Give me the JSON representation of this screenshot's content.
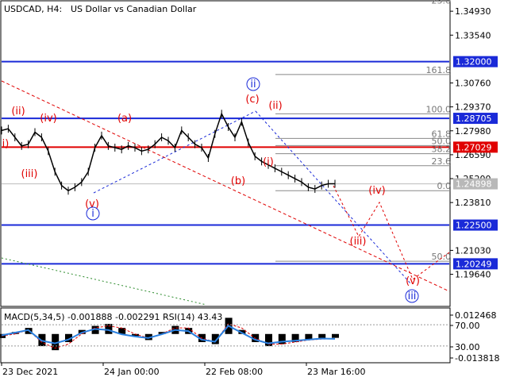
{
  "header": {
    "symbol": "USDCAD, H4:",
    "description": "US Dollar vs Canadian Dollar"
  },
  "colors": {
    "bg": "#ffffff",
    "axis": "#000000",
    "price_line_blue": "#1a2ad8",
    "price_line_red": "#e00000",
    "label_bg_blue": "#1a2ad8",
    "label_bg_red": "#e00000",
    "label_bg_gray": "#b8b8b8",
    "fib": "#808080",
    "candles": "#000000",
    "macd_hist": "#000000",
    "macd_signal": "#e00000",
    "rsi": "#2a80e0",
    "forecast_red": "#e00000",
    "forecast_blue": "#1a2ad8"
  },
  "chart_data": [
    {
      "type": "line",
      "title": "USDCAD, H4:  US Dollar vs Canadian Dollar",
      "ylim": [
        1.1782,
        1.3549
      ],
      "price_axis_ticks": [
        "1.34930",
        "1.33540",
        "1.30760",
        "1.29370",
        "1.27980",
        "1.26590",
        "1.25200",
        "1.23810",
        "1.21030",
        "1.19640"
      ],
      "x_labels": [
        "23 Dec 2021",
        "24 Jan 00:00",
        "22 Feb 08:00",
        "23 Mar 16:00"
      ],
      "grid": false,
      "levels": [
        {
          "value": 1.32,
          "label": "1.32000",
          "color": "#1a2ad8",
          "style": "solid"
        },
        {
          "value": 1.28705,
          "label": "1.28705",
          "color": "#1a2ad8",
          "style": "solid"
        },
        {
          "value": 1.27029,
          "label": "1.27029",
          "color": "#e00000",
          "style": "solid"
        },
        {
          "value": 1.24898,
          "label": "1.24898",
          "color": "#b8b8b8",
          "style": "current"
        },
        {
          "value": 1.225,
          "label": "1.22500",
          "color": "#1a2ad8",
          "style": "solid"
        },
        {
          "value": 1.20249,
          "label": "1.20249",
          "color": "#1a2ad8",
          "style": "solid"
        }
      ],
      "fibonacci": [
        {
          "label": "23.6",
          "value": 1.3528
        },
        {
          "label": "161.8",
          "value": 1.3125
        },
        {
          "label": "100.0",
          "value": 1.2897
        },
        {
          "label": "61.8",
          "value": 1.2754
        },
        {
          "label": "50.0",
          "value": 1.2712
        },
        {
          "label": "38.2",
          "value": 1.2665
        },
        {
          "label": "23.6",
          "value": 1.2595
        },
        {
          "label": "0.0",
          "value": 1.245
        },
        {
          "label": "50.0",
          "value": 1.204
        }
      ],
      "series": [
        {
          "name": "USDCAD H4 close",
          "x": [
            0,
            2,
            4,
            6,
            8,
            10,
            12,
            14,
            16,
            18,
            20,
            22,
            24,
            26,
            28,
            30,
            32,
            34,
            36,
            38,
            40,
            42,
            44,
            46,
            48,
            50,
            52,
            54,
            56,
            58,
            60,
            62,
            64,
            66,
            68,
            70,
            72,
            74,
            76,
            78,
            80,
            82,
            84,
            86,
            88,
            90,
            92,
            94,
            96,
            98,
            100
          ],
          "values": [
            1.28,
            1.281,
            1.276,
            1.271,
            1.272,
            1.279,
            1.276,
            1.268,
            1.256,
            1.248,
            1.245,
            1.247,
            1.25,
            1.256,
            1.27,
            1.277,
            1.271,
            1.27,
            1.269,
            1.271,
            1.27,
            1.268,
            1.269,
            1.272,
            1.276,
            1.274,
            1.27,
            1.28,
            1.276,
            1.272,
            1.27,
            1.264,
            1.278,
            1.2897,
            1.282,
            1.276,
            1.285,
            1.273,
            1.265,
            1.262,
            1.26,
            1.258,
            1.256,
            1.254,
            1.252,
            1.25,
            1.247,
            1.246,
            1.248,
            1.249,
            1.249
          ]
        }
      ],
      "wave_labels_red": [
        "(ii)",
        "(iv)",
        "(iii)",
        "(v)",
        "(a)",
        "(b)",
        "(c)",
        "(ii)",
        "(i)",
        "(iv)",
        "(iii)",
        "(v)",
        "i)"
      ],
      "wave_labels_blue": [
        "i",
        "ii",
        "iii"
      ]
    },
    {
      "type": "line",
      "title": "MACD(5,34,5) -0.001888 -0.002291 RSI(14) 43.43",
      "indicator_label": "MACD(5,34,5) -0.001888 -0.002291 RSI(14) 43.43",
      "ylim": [
        -0.013818,
        0.012468
      ],
      "axis_ticks": [
        "0.012468",
        "70.00",
        "30.00",
        "-0.013818"
      ],
      "x": [
        0,
        4,
        8,
        12,
        16,
        20,
        24,
        28,
        32,
        36,
        40,
        44,
        48,
        52,
        56,
        60,
        64,
        68,
        72,
        76,
        80,
        84,
        88,
        92,
        96,
        100
      ],
      "series": [
        {
          "name": "MACD(5,34,5) histogram",
          "values": [
            -0.002,
            0.001,
            0.003,
            -0.006,
            -0.008,
            -0.004,
            0.002,
            0.004,
            0.005,
            0.003,
            -0.001,
            -0.003,
            0.001,
            0.004,
            0.003,
            -0.004,
            -0.005,
            0.008,
            0.002,
            -0.004,
            -0.006,
            -0.005,
            -0.004,
            -0.003,
            -0.002,
            -0.0019
          ]
        },
        {
          "name": "MACD signal",
          "values": [
            -0.001,
            0.0,
            0.002,
            -0.004,
            -0.007,
            -0.005,
            0.0,
            0.003,
            0.004,
            0.003,
            0.0,
            -0.002,
            0.0,
            0.003,
            0.003,
            -0.002,
            -0.004,
            0.005,
            0.003,
            -0.002,
            -0.005,
            -0.005,
            -0.004,
            -0.003,
            -0.0025,
            -0.0023
          ]
        },
        {
          "name": "RSI(14)",
          "values": [
            50,
            55,
            60,
            40,
            35,
            42,
            55,
            62,
            60,
            52,
            48,
            45,
            52,
            60,
            58,
            42,
            38,
            68,
            55,
            42,
            35,
            38,
            40,
            42,
            44,
            43.43
          ]
        }
      ]
    }
  ]
}
